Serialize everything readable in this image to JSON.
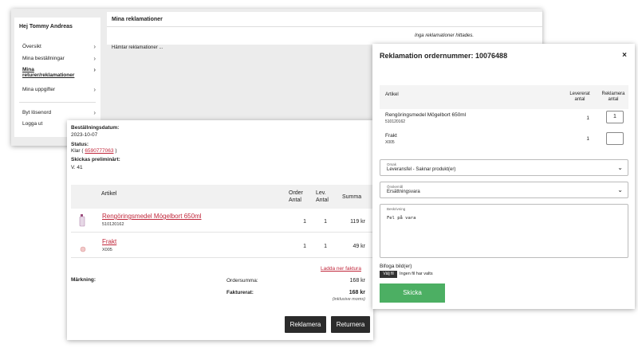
{
  "account": {
    "greeting": "Hej Tommy Andreas",
    "menu": [
      {
        "label": "Översikt"
      },
      {
        "label": "Mina beställningar"
      },
      {
        "label": "Mina returer/reklamationer"
      },
      {
        "label": "Mina uppgifter"
      },
      {
        "label": "Byt lösenord"
      },
      {
        "label": "Logga ut"
      }
    ],
    "main_title": "Mina reklamationer",
    "empty_note": "Inga reklamationer hittades.",
    "loading": "Hämtar reklamationer ..."
  },
  "order": {
    "date_label": "Beställningsdatum:",
    "date_value": "2023-10-07",
    "status_label": "Status:",
    "status_prefix": "Klar (",
    "status_link": "6590777063",
    "status_suffix": ")",
    "ship_label": "Skickas preliminärt:",
    "ship_value": "V. 41",
    "columns": {
      "article": "Artikel",
      "order_qty": "Order Antal",
      "delivered_qty": "Lev. Antal",
      "sum": "Summa"
    },
    "rows": [
      {
        "name": "Rengöringsmedel Mögelbort 650ml",
        "sku": "510120162",
        "order_qty": "1",
        "delivered_qty": "1",
        "sum": "119 kr"
      },
      {
        "name": "Frakt",
        "sku": "X005",
        "order_qty": "1",
        "delivered_qty": "1",
        "sum": "49 kr"
      }
    ],
    "download_invoice": "Ladda ner faktura",
    "marking_label": "Märkning:",
    "order_sum_label": "Ordersumma:",
    "order_sum_value": "168 kr",
    "invoiced_label": "Fakturerat:",
    "invoiced_value": "168 kr",
    "incl_vat": "(inklusive moms)",
    "complain_button": "Reklamera",
    "return_button": "Returnera"
  },
  "modal": {
    "title": "Reklamation ordernummer: 10076488",
    "close": "×",
    "columns": {
      "article": "Artikel",
      "delivered": "Levererat antal",
      "complain": "Reklamera antal"
    },
    "rows": [
      {
        "name": "Rengöringsmedel Mögelbort 650ml",
        "sku": "510120162",
        "delivered": "1",
        "complain_value": "1"
      },
      {
        "name": "Frakt",
        "sku": "X005",
        "delivered": "1",
        "complain_value": ""
      }
    ],
    "reason": {
      "label": "Orsak",
      "value": "Leveransfel - Saknar produkt(er)"
    },
    "wish": {
      "label": "Önskemål",
      "value": "Ersättningsvara"
    },
    "description": {
      "label": "Beskrivning",
      "value": "Fel på vara"
    },
    "attach_label": "Bifoga bild(er)",
    "choose_file": "Välj fil",
    "no_file": "Ingen fil har valts",
    "submit": "Skicka"
  }
}
